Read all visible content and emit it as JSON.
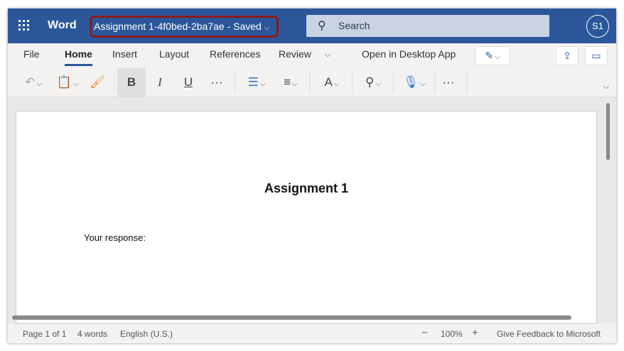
{
  "title_bar": {
    "app_name": "Word",
    "document_name": "Assignment 1-4f0bed-2ba7ae  -  Saved",
    "search_placeholder": "Search",
    "avatar_initials": "S1"
  },
  "tabs": [
    {
      "label": "File"
    },
    {
      "label": "Home",
      "active": true
    },
    {
      "label": "Insert"
    },
    {
      "label": "Layout"
    },
    {
      "label": "References"
    },
    {
      "label": "Review"
    }
  ],
  "open_desktop": "Open in Desktop App",
  "toolbar": {
    "bold": "B",
    "italic": "I",
    "underline": "U",
    "more": "···"
  },
  "document": {
    "heading": "Assignment 1",
    "body": "Your response:"
  },
  "status": {
    "page": "Page 1 of 1",
    "words": "4 words",
    "language": "English (U.S.)",
    "zoom_out": "−",
    "zoom": "100%",
    "zoom_in": "+",
    "feedback": "Give Feedback to Microsoft"
  },
  "colors": {
    "brand": "#2b579a",
    "highlight": "#8b1a1a"
  }
}
